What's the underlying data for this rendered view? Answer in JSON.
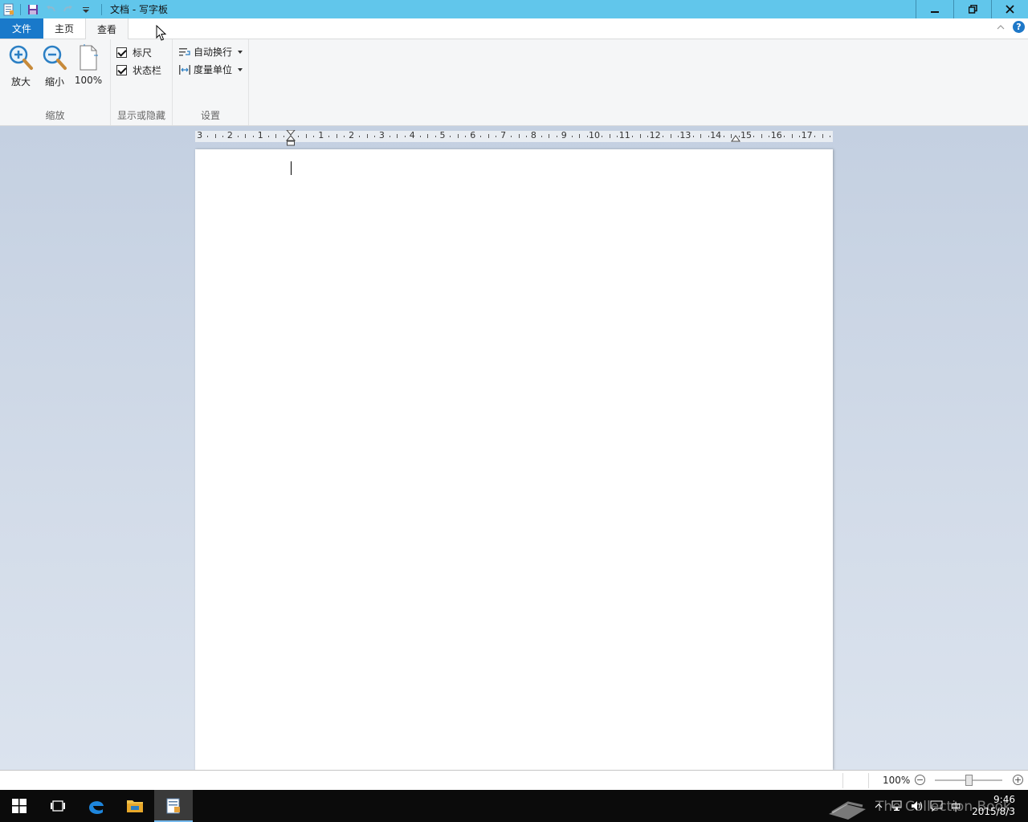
{
  "window": {
    "title": "文档 - 写字板",
    "app_icon": "wordpad-icon",
    "controls": {
      "minimize": "minimize-icon",
      "restore": "restore-icon",
      "close": "close-icon"
    }
  },
  "quick_access": {
    "save_icon": "save-icon",
    "undo_icon": "undo-icon",
    "redo_icon": "redo-icon",
    "customize_icon": "chevron-down-icon"
  },
  "tabs": [
    {
      "label": "文件"
    },
    {
      "label": "主页"
    },
    {
      "label": "查看"
    }
  ],
  "ribbon": {
    "zoom_group": {
      "label": "缩放",
      "zoom_in": "放大",
      "zoom_out": "缩小",
      "hundred": "100%"
    },
    "show_hide_group": {
      "label": "显示或隐藏",
      "ruler": "标尺",
      "statusbar": "状态栏",
      "ruler_checked": true,
      "statusbar_checked": true
    },
    "settings_group": {
      "label": "设置",
      "word_wrap": "自动换行",
      "measurement_units": "度量单位"
    }
  },
  "ruler": {
    "labels": [
      "3",
      "2",
      "1",
      "1",
      "2",
      "3",
      "4",
      "5",
      "6",
      "7",
      "8",
      "9",
      "10",
      "11",
      "12",
      "13",
      "14",
      "15",
      "16",
      "17"
    ]
  },
  "status": {
    "zoom": "100%",
    "zoom_out_symbol": "−",
    "zoom_in_symbol": "+"
  },
  "taskbar": {
    "clock_time": "9:46",
    "clock_date": "2015/8/3",
    "ime": "中"
  },
  "watermark": "The Collection Book",
  "colors": {
    "titlebar": "#61c6eb",
    "file_tab": "#1979ca",
    "ribbon": "#f5f6f7",
    "workspace": "#c4d0e1"
  }
}
